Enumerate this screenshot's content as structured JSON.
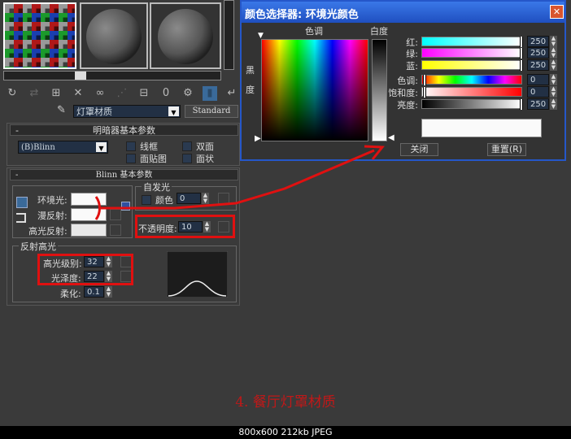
{
  "material_editor": {
    "material_name": "灯罩材质",
    "material_type": "Standard",
    "shader_rollout": {
      "title": "明暗器基本参数",
      "shader": "(B)Blinn",
      "options": [
        {
          "label": "线框"
        },
        {
          "label": "双面"
        },
        {
          "label": "面贴图"
        },
        {
          "label": "面状"
        }
      ],
      "collapse": "-"
    },
    "blinn_rollout": {
      "title": "Blinn 基本参数",
      "collapse": "-",
      "ambient_label": "环境光:",
      "diffuse_label": "漫反射:",
      "specular_label": "高光反射:",
      "self_illum": {
        "title": "自发光",
        "color_label": "颜色",
        "value": "0"
      },
      "opacity": {
        "label": "不透明度:",
        "value": "10"
      },
      "specular_highlights": {
        "title": "反射高光",
        "level_label": "高光级别:",
        "level": "32",
        "gloss_label": "光泽度:",
        "gloss": "22",
        "soften_label": "柔化:",
        "soften": "0.1"
      }
    }
  },
  "color_picker": {
    "title": "颜色选择器: 环境光颜色",
    "hue_label": "色调",
    "whiteness_label": "白度",
    "blackness_label": [
      "黑",
      "度"
    ],
    "rows": [
      {
        "label": "红:",
        "value": "250",
        "gradient": "linear-gradient(90deg,#00ffff,#ffffff)",
        "pos": 98
      },
      {
        "label": "绿:",
        "value": "250",
        "gradient": "linear-gradient(90deg,#ff00ff,#ffffff)",
        "pos": 98
      },
      {
        "label": "蓝:",
        "value": "250",
        "gradient": "linear-gradient(90deg,#ffff00,#ffffff)",
        "pos": 98
      },
      {
        "label": "色调:",
        "value": "0",
        "gradient": "linear-gradient(90deg,#f00,#ff0,#0f0,#0ff,#00f,#f0f,#f00)",
        "pos": 1
      },
      {
        "label": "饱和度:",
        "value": "0",
        "gradient": "linear-gradient(90deg,#fff,#f00)",
        "pos": 1
      },
      {
        "label": "亮度:",
        "value": "250",
        "gradient": "linear-gradient(90deg,#000,#fff)",
        "pos": 98
      }
    ],
    "close_label": "关闭",
    "reset_label": "重置(R)",
    "close_icon": "✕"
  },
  "caption": "4. 餐厅灯罩材质",
  "image_info": "800x600 212kb JPEG",
  "colors": {
    "annotation_red": "#e01010",
    "title_blue": "#2557c9"
  }
}
